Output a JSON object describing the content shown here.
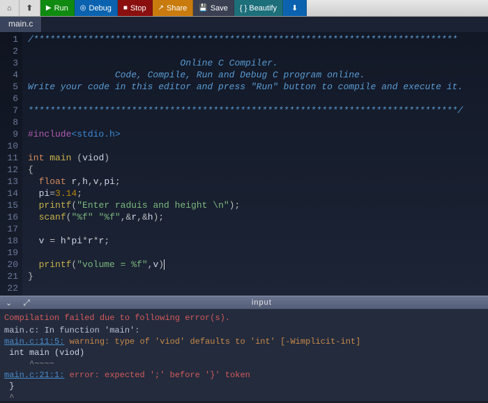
{
  "toolbar": {
    "back": "⌂",
    "up": "⬆",
    "run": "Run",
    "debug": "Debug",
    "stop": "Stop",
    "share": "Share",
    "save": "Save",
    "beautify": "{ } Beautify",
    "download": "⬇"
  },
  "tabs": [
    {
      "label": "main.c"
    }
  ],
  "code": {
    "lines": [
      "/******************************************************************************",
      "",
      "                            Online C Compiler.",
      "                Code, Compile, Run and Debug C program online.",
      "Write your code in this editor and press \"Run\" button to compile and execute it.",
      "",
      "*******************************************************************************/",
      "",
      "#include<stdio.h>",
      "",
      "int main (viod)",
      "{",
      "  float r,h,v,pi;",
      "  pi=3.14;",
      "  printf(\"Enter raduis and height \\n\");",
      "  scanf(\"%f\" \"%f\",&r,&h);",
      "",
      "  v = h*pi*r*r;",
      "",
      "  printf(\"volume = %f\",v)",
      "}",
      ""
    ]
  },
  "divider": {
    "label": "input"
  },
  "console": {
    "header": "Compilation failed due to following error(s).",
    "lines": [
      {
        "text": "main.c: In function 'main':"
      },
      {
        "link": "main.c:11:5:",
        "rest": " warning: type of 'viod' defaults to 'int' [-Wimplicit-int]"
      },
      {
        "code": " int main (viod)"
      },
      {
        "caret": "     ^~~~~"
      },
      {
        "link": "main.c:21:1:",
        "rest": " error: expected ';' before '}' token"
      },
      {
        "code": " }"
      },
      {
        "caret": " ^"
      }
    ]
  }
}
